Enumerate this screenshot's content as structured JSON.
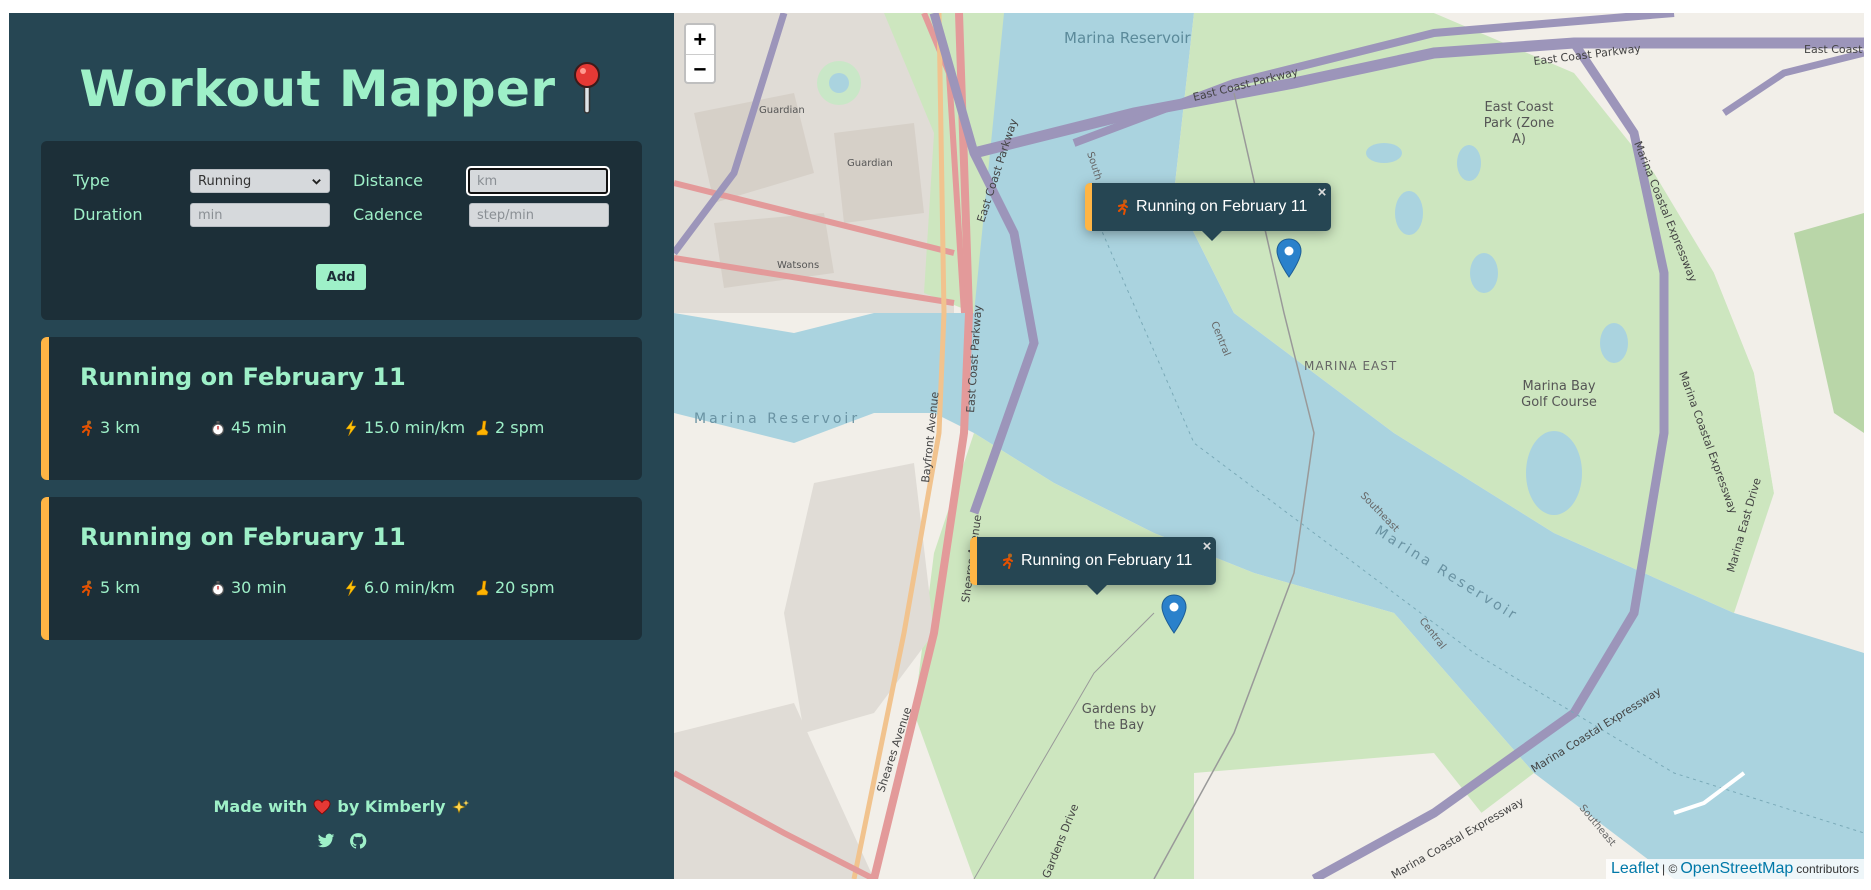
{
  "app": {
    "title": "Workout Mapper",
    "colors": {
      "sidebar": "#264653",
      "panel": "#1c2f38",
      "accent": "#9ef0c8",
      "running": "#ffb545"
    }
  },
  "form": {
    "type_label": "Type",
    "type_value": "Running",
    "distance_label": "Distance",
    "distance_placeholder": "km",
    "duration_label": "Duration",
    "duration_placeholder": "min",
    "cadence_label": "Cadence",
    "cadence_placeholder": "step/min",
    "add_label": "Add"
  },
  "workouts": [
    {
      "title": "Running on February 11",
      "distance": "3 km",
      "duration": "45 min",
      "pace": "15.0 min/km",
      "cadence": "2 spm",
      "icons": [
        "runner-icon",
        "stopwatch-icon",
        "lightning-icon",
        "footprint-icon"
      ]
    },
    {
      "title": "Running on February 11",
      "distance": "5 km",
      "duration": "30 min",
      "pace": "6.0 min/km",
      "cadence": "20 spm",
      "icons": [
        "runner-icon",
        "stopwatch-icon",
        "lightning-icon",
        "footprint-icon"
      ]
    }
  ],
  "footer": {
    "made_with": "Made with",
    "by": "by Kimberly",
    "icons": [
      "heart-icon",
      "sparkles-icon",
      "twitter-icon",
      "github-icon"
    ]
  },
  "map": {
    "zoom_in": "+",
    "zoom_out": "−",
    "popups": [
      {
        "text": "Running on February 11",
        "close": "×"
      },
      {
        "text": "Running on February 11",
        "close": "×"
      }
    ],
    "attribution": {
      "leaflet": "Leaflet",
      "sep": "| ©",
      "osm": "OpenStreetMap",
      "contributors": "contributors"
    },
    "labels": {
      "marina_reservoir_top": "Marina Reservoir",
      "marina_reservoir_left": "Marina Reservoir",
      "marina_reservoir_right": "Marina Reservoir",
      "east_coast_parkway_1": "East Coast Parkway",
      "east_coast_parkway_2": "East Coast Parkway",
      "east_coast_parkway_3": "East Coast Parkway",
      "east_coast_parkway_4": "East Coast Parkway",
      "east_coast_parkway_5": "East Coast Parkway",
      "east_coast_park_1": "East Coast",
      "east_coast_park_2": "Park (Zone",
      "east_coast_park_3": "A)",
      "marina_east": "MARINA EAST",
      "golf_1": "Marina Bay",
      "golf_2": "Golf Course",
      "gardens_1": "Gardens by",
      "gardens_2": "the Bay",
      "guardian_1": "Guardian",
      "guardian_2": "Guardian",
      "watsons": "Watsons",
      "bayfront_avenue": "Bayfront Avenue",
      "sheares_avenue_1": "Sheares Avenue",
      "sheares_avenue_2": "Sheares Avenue",
      "gardens_drive": "Gardens Drive",
      "marina_coastal_1": "Marina Coastal Expressway",
      "marina_coastal_2": "Marina Coastal Expressway",
      "marina_coastal_3": "Marina Coastal Expressway",
      "marina_coastal_4": "Marina Coastal Expressway",
      "marina_east_drive": "Marina East Drive",
      "central_1": "Central",
      "central_2": "Central",
      "southeast_1": "Southeast",
      "southeast_2": "Southeast",
      "south": "South"
    }
  }
}
